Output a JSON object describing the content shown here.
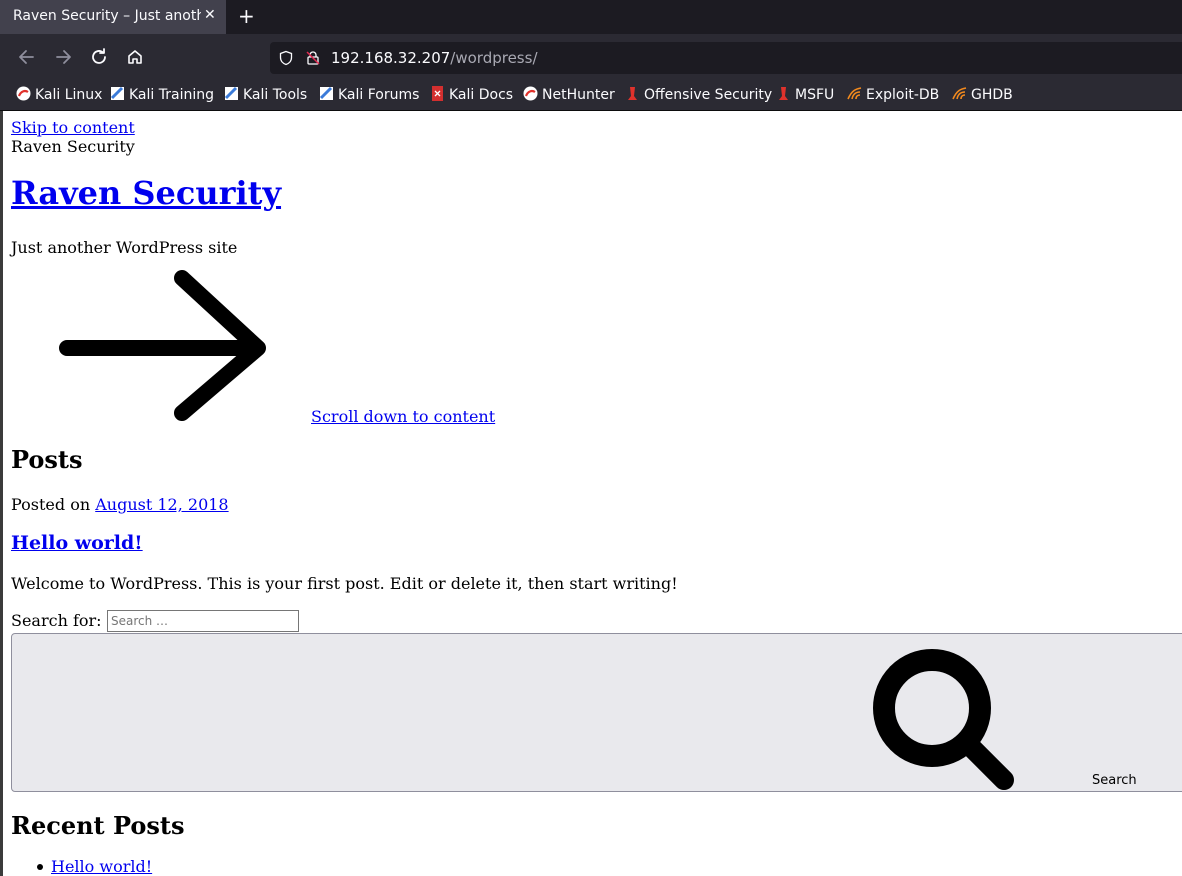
{
  "browser": {
    "tab_title": "Raven Security – Just another WordPress site",
    "tab_close": "✕",
    "new_tab": "+",
    "url_host": "192.168.32.207",
    "url_path": "/wordpress/",
    "bookmarks": [
      {
        "label": "Kali Linux",
        "icon": "kali-dragon-icon"
      },
      {
        "label": "Kali Training",
        "icon": "kali-training-icon"
      },
      {
        "label": "Kali Tools",
        "icon": "kali-tools-icon"
      },
      {
        "label": "Kali Forums",
        "icon": "kali-forums-icon"
      },
      {
        "label": "Kali Docs",
        "icon": "kali-docs-icon"
      },
      {
        "label": "NetHunter",
        "icon": "nethunter-icon"
      },
      {
        "label": "Offensive Security",
        "icon": "offsec-icon"
      },
      {
        "label": "MSFU",
        "icon": "msfu-icon"
      },
      {
        "label": "Exploit-DB",
        "icon": "exploit-db-icon"
      },
      {
        "label": "GHDB",
        "icon": "ghdb-icon"
      }
    ]
  },
  "page": {
    "skip_link": "Skip to content",
    "site_name": "Raven Security",
    "site_title": "Raven Security",
    "tagline": "Just another WordPress site",
    "scroll_link": "Scroll down to content",
    "posts_heading": "Posts",
    "posted_on_label": "Posted on",
    "post_date": "August 12, 2018",
    "post_title": "Hello world!",
    "excerpt": "Welcome to WordPress. This is your first post. Edit or delete it, then start writing!",
    "search_label": "Search for:",
    "search_placeholder": "Search …",
    "search_button": "Search",
    "recent_heading": "Recent Posts",
    "recent_posts": [
      "Hello world!"
    ]
  },
  "colors": {
    "tab_bar": "#1c1b22",
    "toolbar": "#2b2a33",
    "link": "#0000ee"
  }
}
